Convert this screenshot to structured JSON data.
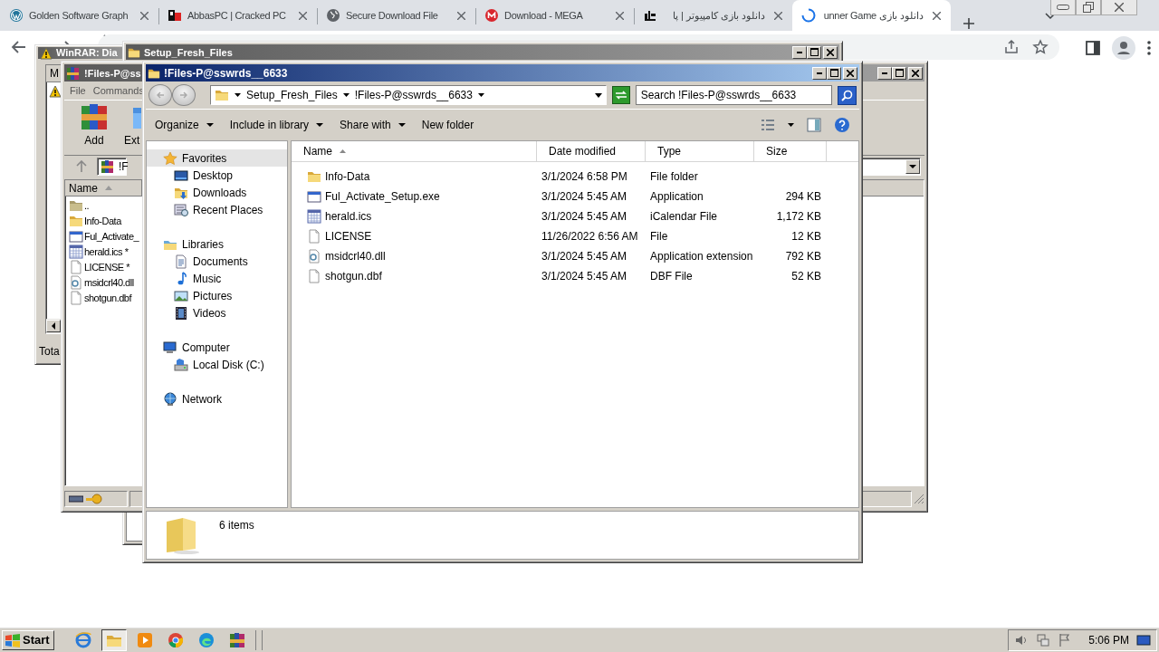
{
  "browser": {
    "tabs": [
      {
        "title": "Golden Software Graph",
        "kind": "wordpress",
        "selected": false
      },
      {
        "title": "AbbasPC | Cracked PC",
        "kind": "abbas",
        "selected": false
      },
      {
        "title": "Secure Download File",
        "kind": "globe",
        "selected": false
      },
      {
        "title": "Download - MEGA",
        "kind": "mega",
        "selected": false
      },
      {
        "title": "دانلود بازی کامپیوتر | پا",
        "kind": "game",
        "selected": false
      },
      {
        "title": "دانلود بازی unner Game",
        "kind": "loading",
        "selected": true
      }
    ]
  },
  "diag_window": {
    "title": "WinRAR: Dia",
    "column": "M",
    "status": "Tota"
  },
  "setup_window": {
    "title": "Setup_Fresh_Files"
  },
  "winrar_window": {
    "title": "!Files-P@ss",
    "menu": [
      "File",
      "Commands"
    ],
    "tools": [
      {
        "label": "Add",
        "kind": "add"
      },
      {
        "label": "Ext",
        "kind": "extract"
      }
    ],
    "path": "!F",
    "column": {
      "label": "Name",
      "sorted": true
    },
    "files": [
      {
        "name": "..",
        "kind": "up"
      },
      {
        "name": "Info-Data",
        "kind": "folder"
      },
      {
        "name": "Ful_Activate_",
        "kind": "exe"
      },
      {
        "name": "herald.ics *",
        "kind": "calendar"
      },
      {
        "name": "LICENSE *",
        "kind": "file"
      },
      {
        "name": "msidcrl40.dll",
        "kind": "dll"
      },
      {
        "name": "shotgun.dbf",
        "kind": "file"
      }
    ]
  },
  "explorer": {
    "title": "!Files-P@sswrds__6633",
    "breadcrumb": [
      "Setup_Fresh_Files",
      "!Files-P@sswrds__6633"
    ],
    "search": {
      "placeholder": "Search !Files-P@sswrds__6633"
    },
    "commands": [
      "Organize",
      "Include in library",
      "Share with",
      "New folder"
    ],
    "nav": [
      {
        "label": "Favorites",
        "kind": "favorites",
        "selected": true,
        "children": [
          {
            "label": "Desktop",
            "kind": "desktop",
            "selected": false
          },
          {
            "label": "Downloads",
            "kind": "downloads",
            "selected": false
          },
          {
            "label": "Recent Places",
            "kind": "recent",
            "selected": false
          }
        ]
      },
      {
        "label": "Libraries",
        "kind": "libraries",
        "selected": false,
        "children": [
          {
            "label": "Documents",
            "kind": "documents",
            "selected": false
          },
          {
            "label": "Music",
            "kind": "music",
            "selected": false
          },
          {
            "label": "Pictures",
            "kind": "pictures",
            "selected": false
          },
          {
            "label": "Videos",
            "kind": "videos",
            "selected": false
          }
        ]
      },
      {
        "label": "Computer",
        "kind": "computer",
        "selected": false,
        "children": [
          {
            "label": "Local Disk (C:)",
            "kind": "disk",
            "selected": false
          }
        ]
      },
      {
        "label": "Network",
        "kind": "network",
        "selected": false
      }
    ],
    "columns": [
      {
        "label": "Name",
        "sorted": true
      },
      {
        "label": "Date modified",
        "sorted": false
      },
      {
        "label": "Type",
        "sorted": false
      },
      {
        "label": "Size",
        "sorted": false
      }
    ],
    "files": [
      {
        "name": "Info-Data",
        "date": "3/1/2024 6:58 PM",
        "type": "File folder",
        "kind": "folder"
      },
      {
        "name": "Ful_Activate_Setup.exe",
        "date": "3/1/2024 5:45 AM",
        "type": "Application",
        "size": "294 KB",
        "kind": "exe"
      },
      {
        "name": "herald.ics",
        "date": "3/1/2024 5:45 AM",
        "type": "iCalendar File",
        "size": "1,172 KB",
        "kind": "calendar"
      },
      {
        "name": "LICENSE",
        "date": "11/26/2022 6:56 AM",
        "type": "File",
        "size": "12 KB",
        "kind": "file"
      },
      {
        "name": "msidcrl40.dll",
        "date": "3/1/2024 5:45 AM",
        "type": "Application extension",
        "size": "792 KB",
        "kind": "dll"
      },
      {
        "name": "shotgun.dbf",
        "date": "3/1/2024 5:45 AM",
        "type": "DBF File",
        "size": "52 KB",
        "kind": "file"
      }
    ],
    "status": "6 items"
  },
  "taskbar": {
    "start": "Start",
    "clock": "5:06 PM",
    "apps": [
      {
        "kind": "ie",
        "selected": false
      },
      {
        "kind": "explorer",
        "selected": true
      },
      {
        "kind": "media",
        "selected": false
      },
      {
        "kind": "chrome",
        "selected": false
      },
      {
        "kind": "edge",
        "selected": false
      },
      {
        "kind": "winrar",
        "selected": false
      }
    ]
  }
}
